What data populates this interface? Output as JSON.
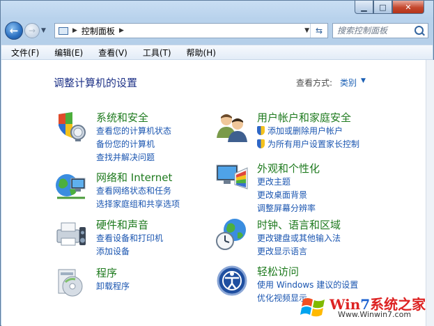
{
  "window": {
    "caption": {
      "minimize_glyph": "▁",
      "maximize_glyph": "□",
      "close_glyph": "✕"
    }
  },
  "nav": {
    "address": "控制面板",
    "search_placeholder": "搜索控制面板"
  },
  "menu": [
    "文件(F)",
    "编辑(E)",
    "查看(V)",
    "工具(T)",
    "帮助(H)"
  ],
  "main": {
    "title": "调整计算机的设置",
    "view_by_label": "查看方式:",
    "view_by_value": "类别"
  },
  "categories": [
    {
      "title": "系统和安全",
      "icon": "system-security-icon",
      "links": [
        "查看您的计算机状态",
        "备份您的计算机",
        "查找并解决问题"
      ]
    },
    {
      "title": "网络和 Internet",
      "icon": "network-internet-icon",
      "links": [
        "查看网络状态和任务",
        "选择家庭组和共享选项"
      ]
    },
    {
      "title": "硬件和声音",
      "icon": "hardware-sound-icon",
      "links": [
        "查看设备和打印机",
        "添加设备"
      ]
    },
    {
      "title": "程序",
      "icon": "programs-icon",
      "links": [
        "卸载程序"
      ]
    },
    {
      "title": "用户帐户和家庭安全",
      "icon": "user-accounts-icon",
      "links": [
        "添加或删除用户帐户",
        "为所有用户设置家长控制"
      ]
    },
    {
      "title": "外观和个性化",
      "icon": "appearance-icon",
      "links": [
        "更改主题",
        "更改桌面背景",
        "调整屏幕分辨率"
      ]
    },
    {
      "title": "时钟、语言和区域",
      "icon": "clock-language-icon",
      "links": [
        "更改键盘或其他输入法",
        "更改显示语言"
      ]
    },
    {
      "title": "轻松访问",
      "icon": "ease-of-access-icon",
      "links": [
        "使用 Windows 建议的设置",
        "优化视频显示"
      ]
    }
  ],
  "watermark": {
    "text_a": "Win",
    "text_7": "7",
    "text_b": "系统之家",
    "url": "Www.Winwin7.com"
  },
  "colors": {
    "category_title": "#1e7a1e",
    "link": "#1a55b0",
    "title": "#1e3287"
  }
}
